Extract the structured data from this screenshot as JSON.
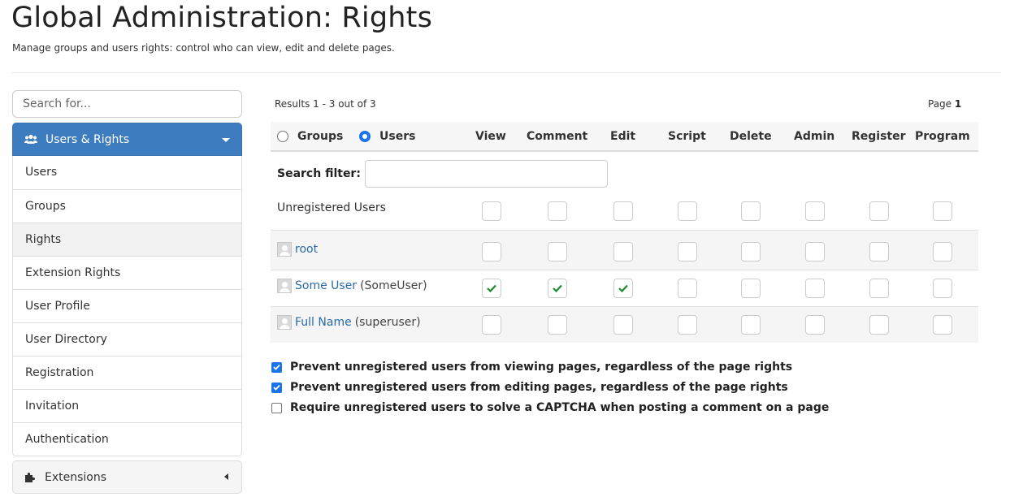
{
  "page": {
    "title": "Global Administration: Rights",
    "subtitle": "Manage groups and users rights: control who can view, edit and delete pages."
  },
  "sidebar": {
    "search_placeholder": "Search for...",
    "section_title": "Users & Rights",
    "items": [
      {
        "label": "Users",
        "active": false
      },
      {
        "label": "Groups",
        "active": false
      },
      {
        "label": "Rights",
        "active": true
      },
      {
        "label": "Extension Rights",
        "active": false
      },
      {
        "label": "User Profile",
        "active": false
      },
      {
        "label": "User Directory",
        "active": false
      },
      {
        "label": "Registration",
        "active": false
      },
      {
        "label": "Invitation",
        "active": false
      },
      {
        "label": "Authentication",
        "active": false
      }
    ],
    "extensions_label": "Extensions"
  },
  "main": {
    "results_text": "Results 1 - 3 out of 3",
    "page_label": "Page",
    "page_number": "1",
    "scope": {
      "groups_label": "Groups",
      "users_label": "Users",
      "selected": "users"
    },
    "columns": [
      "View",
      "Comment",
      "Edit",
      "Script",
      "Delete",
      "Admin",
      "Register",
      "Program"
    ],
    "search_filter_label": "Search filter:",
    "search_filter_value": "",
    "rows": [
      {
        "name": "Unregistered Users",
        "sub": "",
        "avatar": false,
        "link": false,
        "rights": [
          false,
          false,
          false,
          false,
          false,
          false,
          false,
          false
        ]
      },
      {
        "name": "root",
        "sub": "",
        "avatar": true,
        "link": true,
        "rights": [
          false,
          false,
          false,
          false,
          false,
          false,
          false,
          false
        ]
      },
      {
        "name": "Some User",
        "sub": "(SomeUser)",
        "avatar": true,
        "link": true,
        "rights": [
          true,
          true,
          true,
          false,
          false,
          false,
          false,
          false
        ]
      },
      {
        "name": "Full Name",
        "sub": "(superuser)",
        "avatar": true,
        "link": true,
        "rights": [
          false,
          false,
          false,
          false,
          false,
          false,
          false,
          false
        ]
      }
    ],
    "options": [
      {
        "label": "Prevent unregistered users from viewing pages, regardless of the page rights",
        "checked": true
      },
      {
        "label": "Prevent unregistered users from editing pages, regardless of the page rights",
        "checked": true
      },
      {
        "label": "Require unregistered users to solve a CAPTCHA when posting a comment on a page",
        "checked": false
      }
    ]
  },
  "colors": {
    "accent": "#3d7cbf",
    "link": "#2a6aa8",
    "check": "#1e8a2e",
    "checkbox_on": "#1a73e8"
  },
  "icons": {
    "users_section": "users-icon",
    "extensions": "puzzle-icon",
    "granted": "check-icon"
  }
}
